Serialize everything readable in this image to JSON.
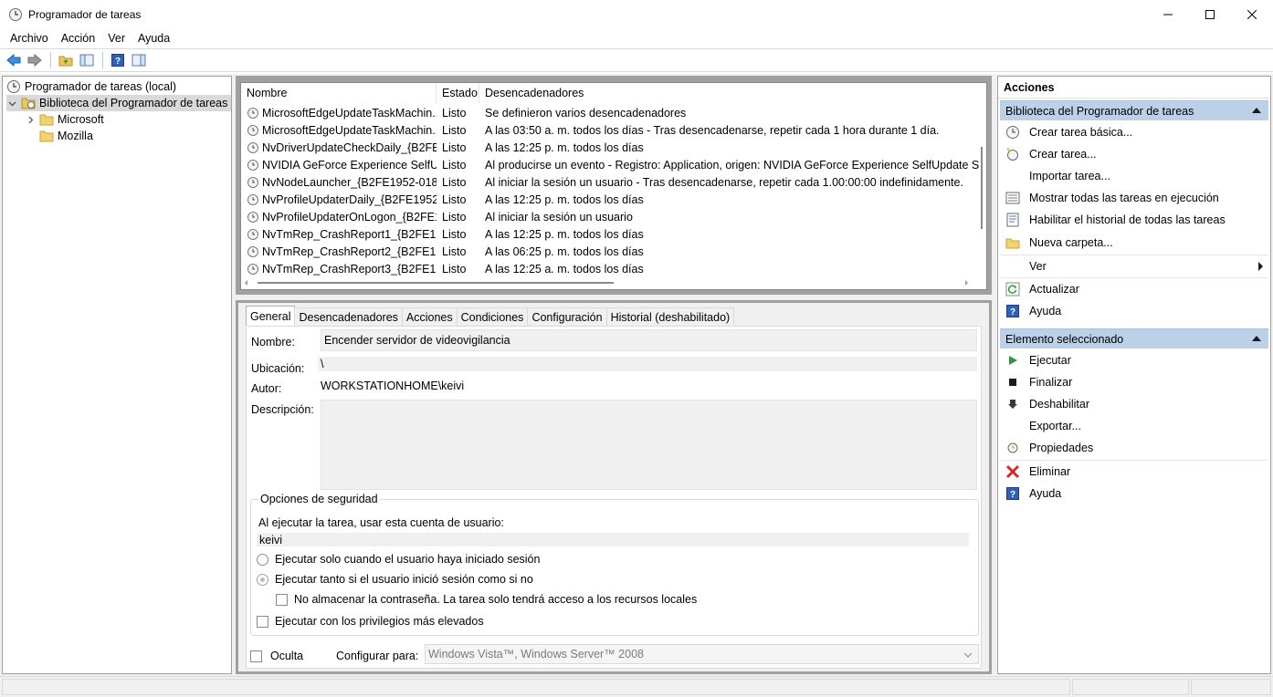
{
  "window": {
    "title": "Programador de tareas"
  },
  "menu": [
    "Archivo",
    "Acción",
    "Ver",
    "Ayuda"
  ],
  "tree": {
    "root": "Programador de tareas (local)",
    "library": "Biblioteca del Programador de tareas",
    "children": [
      "Microsoft",
      "Mozilla"
    ]
  },
  "task_list": {
    "columns": [
      "Nombre",
      "Estado",
      "Desencadenadores"
    ],
    "rows": [
      {
        "name": "MicrosoftEdgeUpdateTaskMachin...",
        "status": "Listo",
        "trigger": "Se definieron varios desencadenadores"
      },
      {
        "name": "MicrosoftEdgeUpdateTaskMachin...",
        "status": "Listo",
        "trigger": "A las 03:50 a. m. todos los días - Tras desencadenarse, repetir cada 1 hora durante 1 día."
      },
      {
        "name": "NvDriverUpdateCheckDaily_{B2FE...",
        "status": "Listo",
        "trigger": "A las 12:25 p. m. todos los días"
      },
      {
        "name": "NVIDIA GeForce Experience SelfUp...",
        "status": "Listo",
        "trigger": "Al producirse un evento - Registro: Application, origen: NVIDIA GeForce Experience SelfUpdate Source"
      },
      {
        "name": "NvNodeLauncher_{B2FE1952-0186...",
        "status": "Listo",
        "trigger": "Al iniciar la sesión un usuario - Tras desencadenarse, repetir cada 1.00:00:00 indefinidamente."
      },
      {
        "name": "NvProfileUpdaterDaily_{B2FE1952-...",
        "status": "Listo",
        "trigger": "A las 12:25 p. m. todos los días"
      },
      {
        "name": "NvProfileUpdaterOnLogon_{B2FE1...",
        "status": "Listo",
        "trigger": "Al iniciar la sesión un usuario"
      },
      {
        "name": "NvTmRep_CrashReport1_{B2FE195...",
        "status": "Listo",
        "trigger": "A las 12:25 p. m. todos los días"
      },
      {
        "name": "NvTmRep_CrashReport2_{B2FE195...",
        "status": "Listo",
        "trigger": "A las 06:25 p. m. todos los días"
      },
      {
        "name": "NvTmRep_CrashReport3_{B2FE195...",
        "status": "Listo",
        "trigger": "A las 12:25 a. m. todos los días"
      }
    ]
  },
  "tabs": [
    "General",
    "Desencadenadores",
    "Acciones",
    "Condiciones",
    "Configuración",
    "Historial (deshabilitado)"
  ],
  "general": {
    "name_label": "Nombre:",
    "name_value": "Encender servidor de videovigilancia",
    "location_label": "Ubicación:",
    "location_value": "\\",
    "author_label": "Autor:",
    "author_value": "WORKSTATIONHOME\\keivi",
    "description_label": "Descripción:",
    "description_value": "",
    "security": {
      "title": "Opciones de seguridad",
      "account_label": "Al ejecutar la tarea, usar esta cuenta de usuario:",
      "account_value": "keivi",
      "opt_logged_on": "Ejecutar solo cuando el usuario haya iniciado sesión",
      "opt_always": "Ejecutar tanto si el usuario inició sesión como si no",
      "no_store_password": "No almacenar la contraseña. La tarea solo tendrá acceso a los recursos locales",
      "highest_privileges": "Ejecutar con los privilegios más elevados"
    },
    "hidden_label": "Oculta",
    "configure_label": "Configurar para:",
    "configure_value": "Windows Vista™, Windows Server™ 2008"
  },
  "actions": {
    "header": "Acciones",
    "section1": "Biblioteca del Programador de tareas",
    "items1": [
      "Crear tarea básica...",
      "Crear tarea...",
      "Importar tarea...",
      "Mostrar todas las tareas en ejecución",
      "Habilitar el historial de todas las tareas",
      "Nueva carpeta...",
      "Ver",
      "Actualizar",
      "Ayuda"
    ],
    "section2": "Elemento seleccionado",
    "items2": [
      "Ejecutar",
      "Finalizar",
      "Deshabilitar",
      "Exportar...",
      "Propiedades",
      "Eliminar",
      "Ayuda"
    ]
  }
}
